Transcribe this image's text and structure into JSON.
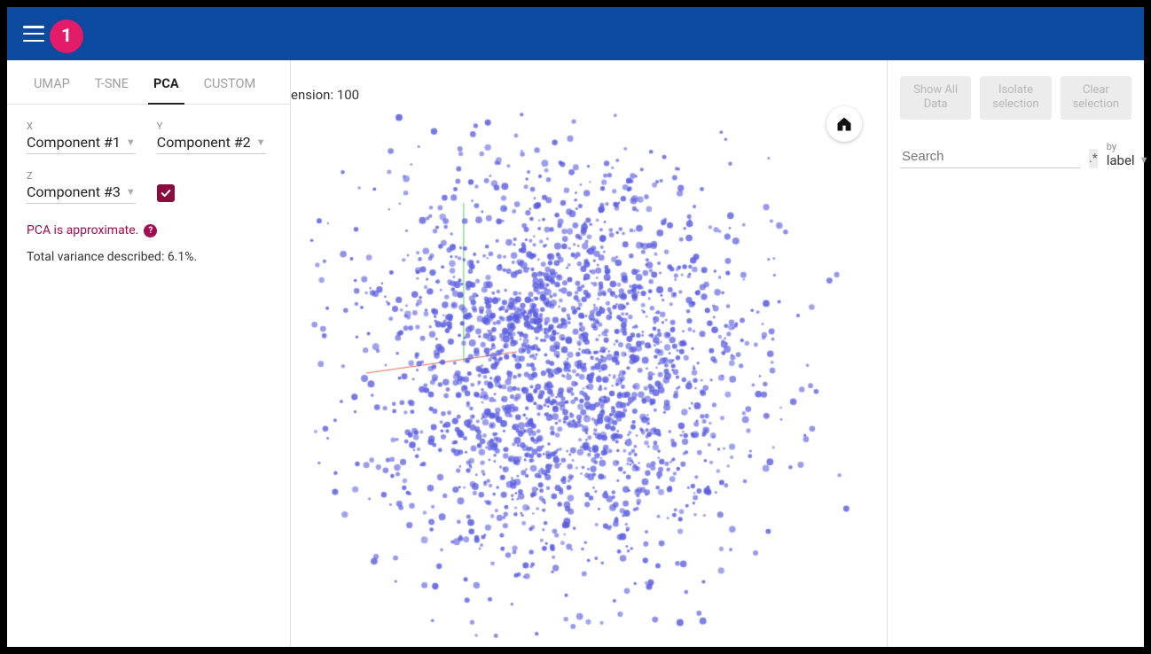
{
  "badge_number": "1",
  "tabs": [
    "UMAP",
    "T-SNE",
    "PCA",
    "CUSTOM"
  ],
  "active_tab_index": 2,
  "controls": {
    "x_label": "X",
    "x_value": "Component #1",
    "y_label": "Y",
    "y_value": "Component #2",
    "z_label": "Z",
    "z_value": "Component #3",
    "checkbox_checked": true
  },
  "approximate_text": "PCA is approximate.",
  "variance_text": "Total variance described: 6.1%.",
  "dimension_text": "ension: 100",
  "buttons": {
    "show_all": "Show All Data",
    "isolate": "Isolate selection",
    "clear": "Clear selection"
  },
  "search": {
    "placeholder": "Search",
    "regex_label": ".*",
    "by_label": "by",
    "by_value": "label"
  },
  "chart_data": {
    "type": "scatter",
    "title": "",
    "xlabel": "",
    "ylabel": "",
    "n_points_approx": 2200,
    "point_color": "#5c5fe0",
    "axis_colors": {
      "x": "#e06a50",
      "y": "#5ac85a"
    },
    "note": "3D PCA projection scatter cloud, densely clustered near center, components 1-3; individual point coordinates not labeled"
  }
}
